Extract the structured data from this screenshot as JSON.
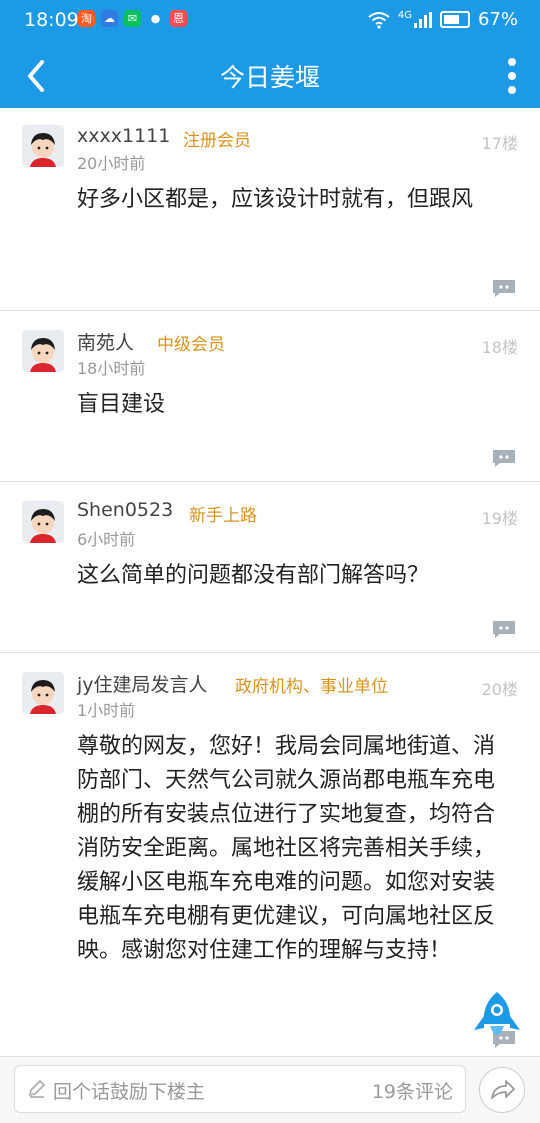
{
  "status_bar": {
    "time": "18:09",
    "apps": [
      {
        "icon": "taobao-icon",
        "glyph": "淘",
        "color": "#ff5a1f"
      },
      {
        "icon": "weather-icon",
        "glyph": "☁",
        "color": "#2f7de1"
      },
      {
        "icon": "wechat-icon",
        "glyph": "✉",
        "color": "#07c160"
      },
      {
        "icon": "message-icon",
        "glyph": "●",
        "color": "#ffffff"
      },
      {
        "icon": "app-icon",
        "glyph": "恩",
        "color": "#ff4d4f"
      }
    ],
    "network": "4G",
    "battery": "67%"
  },
  "nav": {
    "title": "今日姜堰"
  },
  "posts": [
    {
      "username": "xxxx1111",
      "badge": "注册会员",
      "time": "20小时前",
      "floor": "17楼",
      "content": "好多小区都是，应该设计时就有，但跟风"
    },
    {
      "username": "南苑人",
      "badge": "中级会员",
      "time": "18小时前",
      "floor": "18楼",
      "content": "盲目建设"
    },
    {
      "username": "Shen0523",
      "badge": "新手上路",
      "time": "6小时前",
      "floor": "19楼",
      "content": "这么简单的问题都没有部门解答吗？"
    },
    {
      "username": "jy住建局发言人",
      "badge": "政府机构、事业单位",
      "time": "1小时前",
      "floor": "20楼",
      "content": "尊敬的网友，您好！我局会同属地街道、消防部门、天然气公司就久源尚郡电瓶车充电棚的所有安装点位进行了实地复查，均符合消防安全距离。属地社区将完善相关手续，缓解小区电瓶车充电难的问题。如您对安装电瓶车充电棚有更优建议，可向属地社区反映。感谢您对住建工作的理解与支持！"
    }
  ],
  "bottom_bar": {
    "placeholder": "回个话鼓励下楼主",
    "comment_count": "19条评论"
  },
  "colors": {
    "brand": "#1c9ae6",
    "badge": "#d9941e"
  }
}
